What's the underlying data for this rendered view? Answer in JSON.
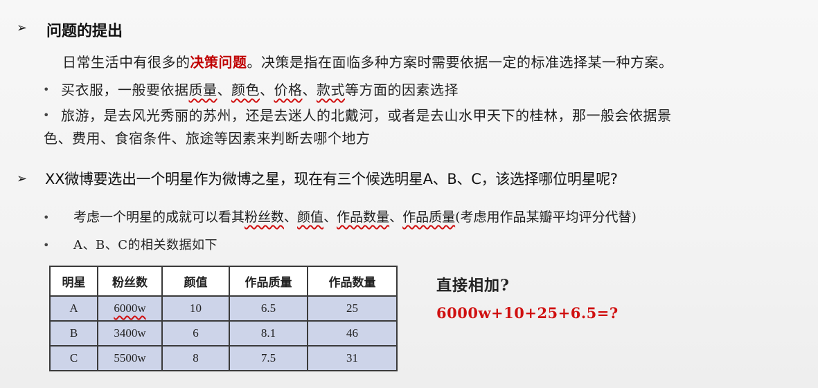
{
  "section1": {
    "title": "问题的提出",
    "intro_before": "日常生活中有很多的",
    "intro_highlight": "决策问题",
    "intro_after": "。决策是指在面临多种方案时需要依据一定的标准选择某一种方案。",
    "bullet1": {
      "prefix": "买衣服，一般要依据",
      "w1": "质量",
      "sep1": "、",
      "w2": "颜色",
      "sep2": "、",
      "w3": "价格",
      "sep3": "、",
      "w4": "款式",
      "suffix": "等方面的因素选择"
    },
    "bullet2": {
      "line1": "旅游，是去风光秀丽的苏州，还是去迷人的北戴河，或者是去山水甲天下的桂林，那一般会依据景",
      "line2": "色、费用、食宿条件、旅途等因素来判断去哪个地方"
    }
  },
  "section2": {
    "title": "XX微博要选出一个明星作为微博之星，现在有三个候选明星A、B、C，该选择哪位明星呢?",
    "bullet1": {
      "prefix": "考虑一个明星的成就可以看其",
      "w1": "粉丝数",
      "sep1": "、",
      "w2": "颜值",
      "sep2": "、",
      "w3": "作品数量",
      "sep3": "、",
      "w4": "作品质量",
      "suffix": "(考虑用作品某瓣平均评分代替)"
    },
    "bullet2": "A、B、C的相关数据如下"
  },
  "table": {
    "headers": [
      "明星",
      "粉丝数",
      "颜值",
      "作品质量",
      "作品数量"
    ],
    "rows": [
      [
        "A",
        "6000w",
        "10",
        "6.5",
        "25"
      ],
      [
        "B",
        "3400w",
        "6",
        "8.1",
        "46"
      ],
      [
        "C",
        "5500w",
        "8",
        "7.5",
        "31"
      ]
    ]
  },
  "question": {
    "title": "直接相加?",
    "formula": "6000w+10+25+6.5=?"
  },
  "bullet_glyph": "•",
  "arrow_glyph": "➢"
}
